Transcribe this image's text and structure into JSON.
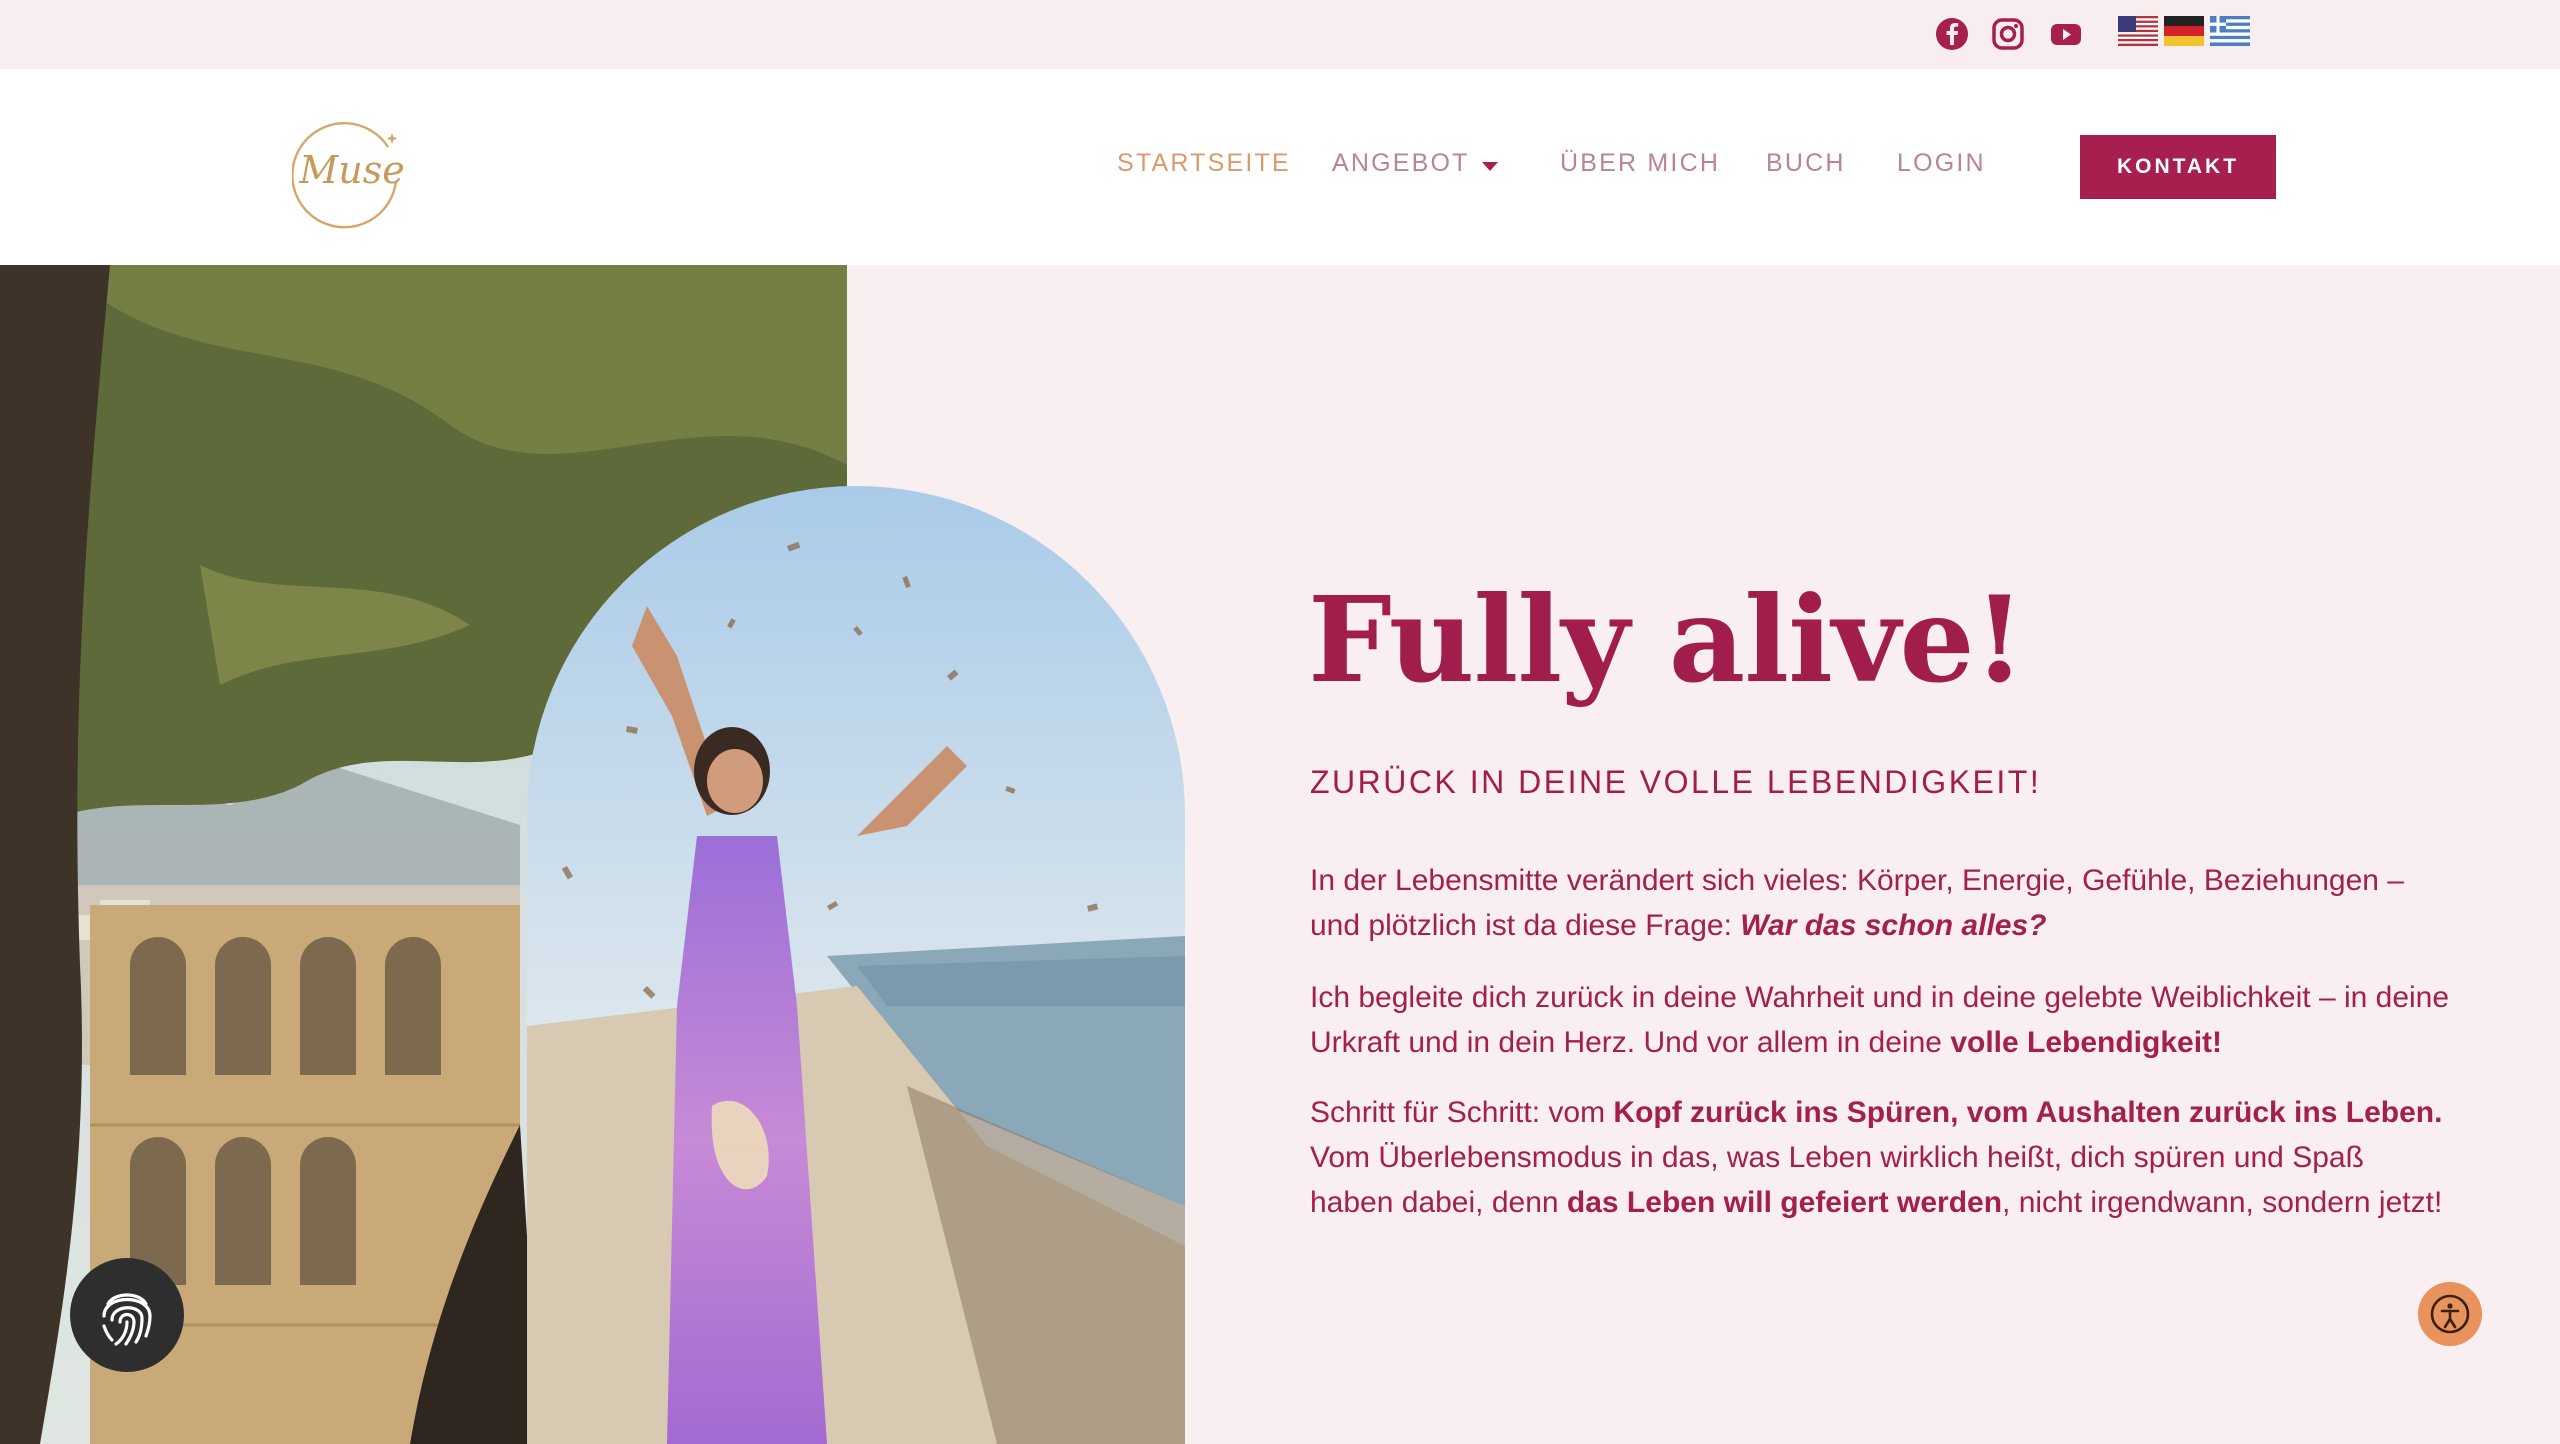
{
  "topbar": {
    "social_icons": [
      "facebook-icon",
      "instagram-icon",
      "youtube-icon"
    ],
    "language_flags": [
      "us-flag-icon",
      "de-flag-icon",
      "gr-flag-icon"
    ]
  },
  "header": {
    "logo_text": "Muse",
    "nav": {
      "home": "STARTSEITE",
      "offer": "ANGEBOT",
      "about": "ÜBER MICH",
      "book": "BUCH",
      "login": "LOGIN"
    },
    "cta": "KONTAKT"
  },
  "hero": {
    "title": "Fully alive!",
    "subtitle": "ZURÜCK IN DEINE VOLLE LEBENDIGKEIT!",
    "p1_a": "In der Lebensmitte verändert sich vieles: Körper, Energie, Gefühle, Beziehungen – und plötzlich ist da diese Frage: ",
    "p1_b": "War das schon alles?",
    "p2_a": "Ich begleite dich zurück in deine Wahrheit und in deine gelebte Weiblichkeit – in deine Urkraft und in dein Herz. Und vor allem in deine ",
    "p2_b": "volle Lebendigkeit!",
    "p3_a": "Schritt für Schritt: vom ",
    "p3_b": "Kopf zurück ins Spüren, vom Aushalten zurück ins Leben.",
    "p3_c": " Vom Überlebensmodus in das, was Leben wirklich heißt, dich spüren und Spaß haben dabei, denn ",
    "p3_d": "das Leben will gefeiert werden",
    "p3_e": ", nicht irgendwann, sondern jetzt!"
  },
  "colors": {
    "accent": "#a61f4f",
    "nav_text": "#b98590",
    "nav_active": "#d99b6c",
    "page_bg": "#f9eef0",
    "access_button": "#e8935c"
  }
}
